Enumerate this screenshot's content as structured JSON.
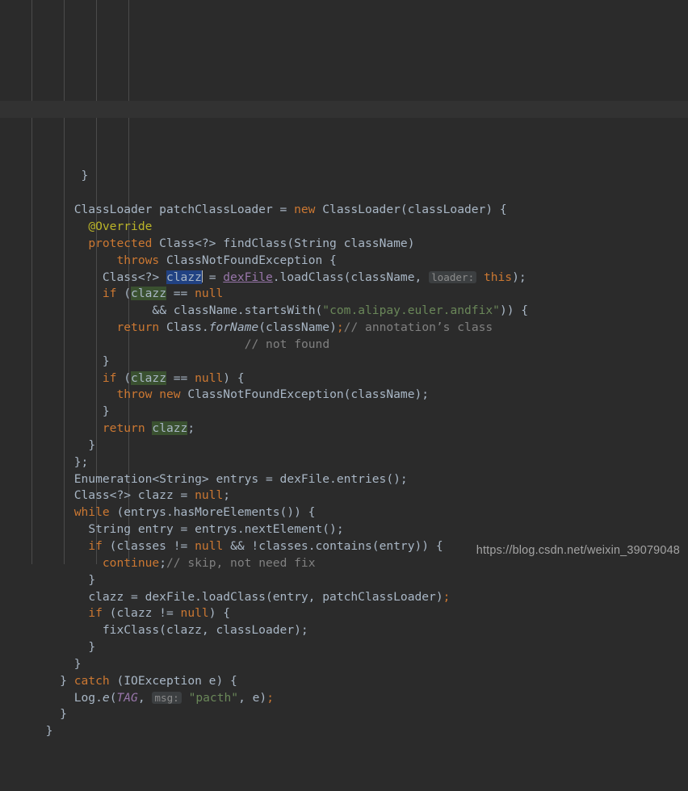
{
  "app": {
    "kind": "code-editor",
    "language": "Java",
    "theme": "Darcula"
  },
  "colors": {
    "background": "#2B2B2B",
    "caret_line": "#323232",
    "default_text": "#A9B7C6",
    "keyword": "#CC7832",
    "string": "#6A8759",
    "comment": "#808080",
    "annotation": "#BBB529",
    "field": "#9876AA",
    "selection": "#214283",
    "occurrence": "#3A5130",
    "inlay_hint_bg": "#3C3F41",
    "inlay_hint_fg": "#8C8C8C",
    "indent_guide": "#4B4B4B"
  },
  "editor": {
    "caret_line_index": 6,
    "selected_text": "clazz",
    "lines": [
      {
        "indent": 7,
        "tokens": [
          {
            "t": "}",
            "c": "txt"
          }
        ]
      },
      {
        "indent": 0,
        "tokens": []
      },
      {
        "indent": 6,
        "tokens": [
          {
            "t": "ClassLoader patchClassLoader = ",
            "c": "txt"
          },
          {
            "t": "new",
            "c": "kw"
          },
          {
            "t": " ClassLoader(classLoader) {",
            "c": "txt"
          }
        ]
      },
      {
        "indent": 8,
        "tokens": [
          {
            "t": "@Override",
            "c": "anno"
          }
        ]
      },
      {
        "indent": 8,
        "tokens": [
          {
            "t": "protected",
            "c": "kw"
          },
          {
            "t": " Class<?> ",
            "c": "txt"
          },
          {
            "t": "findClass",
            "c": "txt"
          },
          {
            "t": "(String className)",
            "c": "txt"
          }
        ]
      },
      {
        "indent": 12,
        "tokens": [
          {
            "t": "throws",
            "c": "kw"
          },
          {
            "t": " ClassNotFoundException {",
            "c": "txt"
          }
        ]
      },
      {
        "indent": 10,
        "tokens": [
          {
            "t": "Class<?> ",
            "c": "txt"
          },
          {
            "t": "clazz",
            "c": "sel"
          },
          {
            "t": "|caret|",
            "c": "caret"
          },
          {
            "t": " = ",
            "c": "txt"
          },
          {
            "t": "dexFile",
            "c": "fld"
          },
          {
            "t": ".loadClass(className, ",
            "c": "txt"
          },
          {
            "t": "loader:",
            "c": "hint"
          },
          {
            "t": " ",
            "c": "txt"
          },
          {
            "t": "this",
            "c": "kw"
          },
          {
            "t": ");",
            "c": "txt"
          }
        ]
      },
      {
        "indent": 10,
        "tokens": [
          {
            "t": "if",
            "c": "kw"
          },
          {
            "t": " (",
            "c": "txt"
          },
          {
            "t": "clazz",
            "c": "occ"
          },
          {
            "t": " == ",
            "c": "txt"
          },
          {
            "t": "null",
            "c": "kw"
          }
        ]
      },
      {
        "indent": 17,
        "tokens": [
          {
            "t": "&& className.startsWith(",
            "c": "txt"
          },
          {
            "t": "\"com.alipay.euler.andfix\"",
            "c": "str"
          },
          {
            "t": ")) {",
            "c": "txt"
          }
        ]
      },
      {
        "indent": 12,
        "tokens": [
          {
            "t": "return",
            "c": "kw"
          },
          {
            "t": " Class.",
            "c": "txt"
          },
          {
            "t": "forName",
            "c": "stat"
          },
          {
            "t": "(className)",
            "c": "txt"
          },
          {
            "t": ";",
            "c": "kw"
          },
          {
            "t": "// annotation’s class",
            "c": "cmt"
          }
        ]
      },
      {
        "indent": 30,
        "tokens": [
          {
            "t": "// not found",
            "c": "cmt"
          }
        ]
      },
      {
        "indent": 10,
        "tokens": [
          {
            "t": "}",
            "c": "txt"
          }
        ]
      },
      {
        "indent": 10,
        "tokens": [
          {
            "t": "if",
            "c": "kw"
          },
          {
            "t": " (",
            "c": "txt"
          },
          {
            "t": "clazz",
            "c": "occ"
          },
          {
            "t": " == ",
            "c": "txt"
          },
          {
            "t": "null",
            "c": "kw"
          },
          {
            "t": ") {",
            "c": "txt"
          }
        ]
      },
      {
        "indent": 12,
        "tokens": [
          {
            "t": "throw",
            "c": "kw"
          },
          {
            "t": " ",
            "c": "txt"
          },
          {
            "t": "new",
            "c": "kw"
          },
          {
            "t": " ClassNotFoundException(className);",
            "c": "txt"
          }
        ]
      },
      {
        "indent": 10,
        "tokens": [
          {
            "t": "}",
            "c": "txt"
          }
        ]
      },
      {
        "indent": 10,
        "tokens": [
          {
            "t": "return",
            "c": "kw"
          },
          {
            "t": " ",
            "c": "txt"
          },
          {
            "t": "clazz",
            "c": "occ"
          },
          {
            "t": ";",
            "c": "txt"
          }
        ]
      },
      {
        "indent": 8,
        "tokens": [
          {
            "t": "}",
            "c": "txt"
          }
        ]
      },
      {
        "indent": 6,
        "tokens": [
          {
            "t": "};",
            "c": "txt"
          }
        ]
      },
      {
        "indent": 6,
        "tokens": [
          {
            "t": "Enumeration<String> entrys = dexFile.entries();",
            "c": "txt"
          }
        ]
      },
      {
        "indent": 6,
        "tokens": [
          {
            "t": "Class<?> clazz = ",
            "c": "txt"
          },
          {
            "t": "null",
            "c": "kw"
          },
          {
            "t": ";",
            "c": "txt"
          }
        ]
      },
      {
        "indent": 6,
        "tokens": [
          {
            "t": "while",
            "c": "kw"
          },
          {
            "t": " (entrys.hasMoreElements()) {",
            "c": "txt"
          }
        ]
      },
      {
        "indent": 8,
        "tokens": [
          {
            "t": "String entry = entrys.nextElement();",
            "c": "txt"
          }
        ]
      },
      {
        "indent": 8,
        "tokens": [
          {
            "t": "if",
            "c": "kw"
          },
          {
            "t": " (classes != ",
            "c": "txt"
          },
          {
            "t": "null",
            "c": "kw"
          },
          {
            "t": " && !classes.contains(entry)) {",
            "c": "txt"
          }
        ]
      },
      {
        "indent": 10,
        "tokens": [
          {
            "t": "continue",
            "c": "kw"
          },
          {
            "t": ";",
            "c": "txt"
          },
          {
            "t": "// skip, not need fix",
            "c": "cmt"
          }
        ]
      },
      {
        "indent": 8,
        "tokens": [
          {
            "t": "}",
            "c": "txt"
          }
        ]
      },
      {
        "indent": 8,
        "tokens": [
          {
            "t": "clazz = dexFile.loadClass(entry, patchClassLoader)",
            "c": "txt"
          },
          {
            "t": ";",
            "c": "kw"
          }
        ]
      },
      {
        "indent": 8,
        "tokens": [
          {
            "t": "if",
            "c": "kw"
          },
          {
            "t": " (clazz != ",
            "c": "txt"
          },
          {
            "t": "null",
            "c": "kw"
          },
          {
            "t": ") {",
            "c": "txt"
          }
        ]
      },
      {
        "indent": 10,
        "tokens": [
          {
            "t": "fixClass(clazz, classLoader);",
            "c": "txt"
          }
        ]
      },
      {
        "indent": 8,
        "tokens": [
          {
            "t": "}",
            "c": "txt"
          }
        ]
      },
      {
        "indent": 6,
        "tokens": [
          {
            "t": "}",
            "c": "txt"
          }
        ]
      },
      {
        "indent": 4,
        "tokens": [
          {
            "t": "} ",
            "c": "txt"
          },
          {
            "t": "catch",
            "c": "kw"
          },
          {
            "t": " (IOException e) {",
            "c": "txt"
          }
        ]
      },
      {
        "indent": 6,
        "tokens": [
          {
            "t": "Log.",
            "c": "txt"
          },
          {
            "t": "e",
            "c": "stat"
          },
          {
            "t": "(",
            "c": "txt"
          },
          {
            "t": "TAG",
            "c": "cst"
          },
          {
            "t": ", ",
            "c": "txt"
          },
          {
            "t": "msg:",
            "c": "hint"
          },
          {
            "t": " ",
            "c": "txt"
          },
          {
            "t": "\"pacth\"",
            "c": "str"
          },
          {
            "t": ", e)",
            "c": "txt"
          },
          {
            "t": ";",
            "c": "kw"
          }
        ]
      },
      {
        "indent": 4,
        "tokens": [
          {
            "t": "}",
            "c": "txt"
          }
        ]
      },
      {
        "indent": 2,
        "tokens": [
          {
            "t": "}",
            "c": "txt"
          }
        ]
      }
    ]
  },
  "watermark": {
    "text": "https://blog.csdn.net/weixin_39079048"
  }
}
